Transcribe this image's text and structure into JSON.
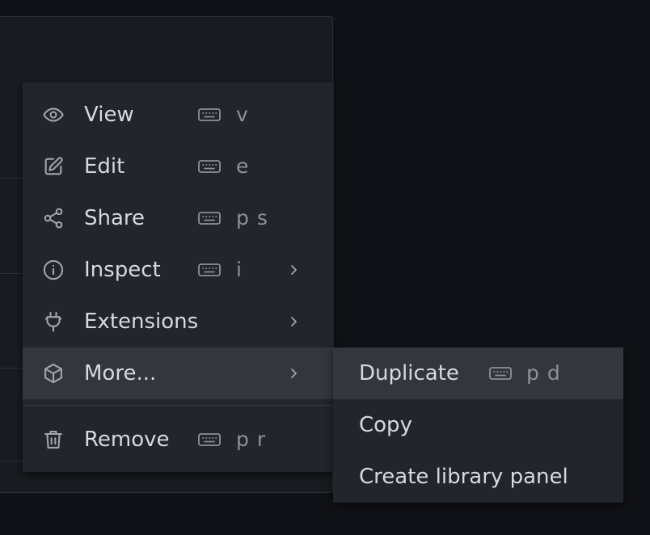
{
  "menu": {
    "items": [
      {
        "label": "View",
        "shortcut": "v",
        "icon": "eye-icon"
      },
      {
        "label": "Edit",
        "shortcut": "e",
        "icon": "edit-icon"
      },
      {
        "label": "Share",
        "shortcut": "p s",
        "icon": "share-icon"
      },
      {
        "label": "Inspect",
        "shortcut": "i",
        "icon": "info-icon"
      },
      {
        "label": "Extensions",
        "icon": "plug-icon"
      },
      {
        "label": "More...",
        "icon": "cube-icon"
      },
      {
        "label": "Remove",
        "shortcut": "p r",
        "icon": "trash-icon"
      }
    ]
  },
  "submenu": {
    "items": [
      {
        "label": "Duplicate",
        "shortcut": "p d"
      },
      {
        "label": "Copy"
      },
      {
        "label": "Create library panel"
      }
    ]
  },
  "colors": {
    "background": "#111217",
    "menu": "#22252b",
    "active": "#34363d",
    "text": "#d8d9dd",
    "muted": "#8e9097"
  }
}
